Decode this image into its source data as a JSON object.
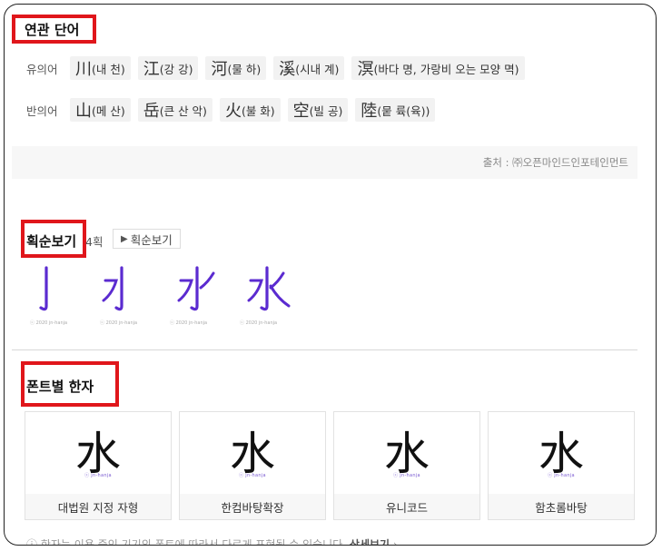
{
  "related": {
    "title": "연관 단어",
    "synonym_label": "유의어",
    "antonym_label": "반의어",
    "synonyms": [
      {
        "hanja": "川",
        "reading": "(내 천)"
      },
      {
        "hanja": "江",
        "reading": "(강 강)"
      },
      {
        "hanja": "河",
        "reading": "(물 하)"
      },
      {
        "hanja": "溪",
        "reading": "(시내 계)"
      },
      {
        "hanja": "溟",
        "reading": "(바다 명, 가랑비 오는 모양 멱)"
      }
    ],
    "antonyms": [
      {
        "hanja": "山",
        "reading": "(메 산)"
      },
      {
        "hanja": "岳",
        "reading": "(큰 산 악)"
      },
      {
        "hanja": "火",
        "reading": "(불 화)"
      },
      {
        "hanja": "空",
        "reading": "(빌 공)"
      },
      {
        "hanja": "陸",
        "reading": "(뭍 륙(육))"
      }
    ],
    "source": "출처 : ㈜오픈마인드인포테인먼트"
  },
  "stroke": {
    "title": "획순보기",
    "count": "4획",
    "button_label": "획순보기",
    "copyright": "ⓒ 2020 jn-hanja",
    "stroke_color": "#5b2bd0"
  },
  "fonts": {
    "title": "폰트별 한자",
    "glyph": "水",
    "watermark": "ⓒ jn-hanja",
    "cards": [
      {
        "label": "대법원 지정 자형"
      },
      {
        "label": "한컴바탕확장"
      },
      {
        "label": "유니코드"
      },
      {
        "label": "함초롬바탕"
      }
    ],
    "notice_text": "한자는 이용 중인 기기의 폰트에 따라서 다르게 표현될 수 있습니다.",
    "notice_link": "상세보기"
  },
  "colors": {
    "highlight": "#e0161b",
    "accent": "#5b2bd0"
  }
}
